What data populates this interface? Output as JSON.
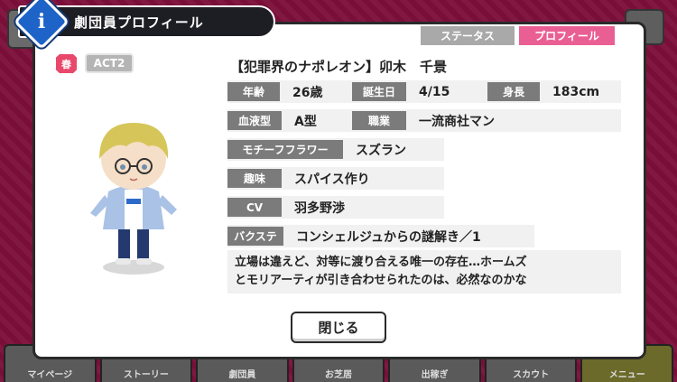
{
  "header": {
    "title": "劇団員プロフィール",
    "info_icon": "i"
  },
  "tabs": [
    {
      "label": "ステータス",
      "active": false
    },
    {
      "label": "プロフィール",
      "active": true
    }
  ],
  "badges": {
    "season": "春",
    "act": "ACT2"
  },
  "profile": {
    "name": "【犯罪界のナポレオン】卯木　千景",
    "age_label": "年齢",
    "age": "26歳",
    "birthday_label": "誕生日",
    "birthday": "4/15",
    "height_label": "身長",
    "height": "183cm",
    "blood_label": "血液型",
    "blood": "A型",
    "job_label": "職業",
    "job": "一流商社マン",
    "flower_label": "モチーフフラワー",
    "flower": "スズラン",
    "hobby_label": "趣味",
    "hobby": "スパイス作り",
    "cv_label": "CV",
    "cv": "羽多野渉",
    "bukusute_label": "バクステ",
    "bukusute": "コンシェルジュからの謎解き／1",
    "description_lines": [
      "立場は違えど、対等に渡り合える唯一の存在…ホームズ",
      "とモリアーティが引き合わせられたのは、必然なのかな"
    ]
  },
  "close_label": "閉じる",
  "bottom_nav": [
    "マイページ",
    "ストーリー",
    "劇団員",
    "お芝居",
    "出稼ぎ",
    "スカウト",
    "メニュー"
  ],
  "colors": {
    "accent_pink": "#ea5f93",
    "label_gray": "#7b7b7b",
    "info_blue": "#1e63c8"
  }
}
